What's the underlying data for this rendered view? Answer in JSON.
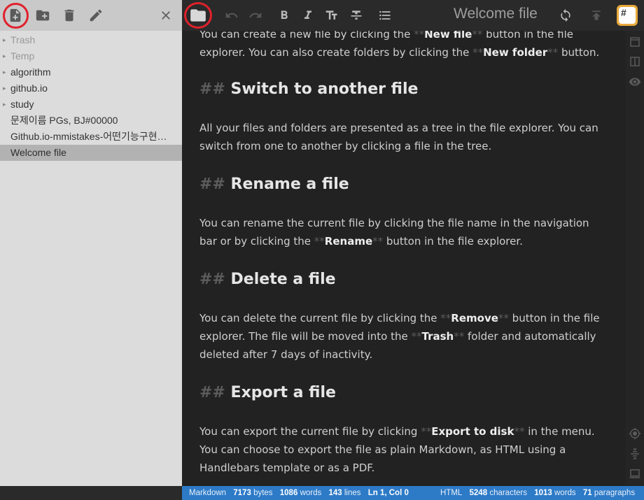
{
  "explorer": {
    "toolbar": {
      "new_file_icon": "new-file-icon",
      "new_folder_icon": "new-folder-icon",
      "delete_icon": "trash-icon",
      "rename_icon": "pencil-icon",
      "close_icon": "close-icon"
    },
    "items": [
      {
        "label": "Trash",
        "type": "folder",
        "dim": true
      },
      {
        "label": "Temp",
        "type": "folder",
        "dim": true
      },
      {
        "label": "algorithm",
        "type": "folder"
      },
      {
        "label": "github.io",
        "type": "folder"
      },
      {
        "label": "study",
        "type": "folder"
      },
      {
        "label": "문제이름 PGs, BJ#00000",
        "type": "file"
      },
      {
        "label": "Github.io-mmistakes-어떤기능구현…",
        "type": "file"
      },
      {
        "label": "Welcome file",
        "type": "file",
        "selected": true
      }
    ]
  },
  "navbar": {
    "title": "Welcome file",
    "workspace_badge": "#",
    "icons": [
      "folder-icon",
      "undo-icon",
      "redo-icon",
      "bold-icon",
      "italic-icon",
      "heading-icon",
      "strikethrough-icon",
      "list-icon",
      "sync-icon",
      "publish-icon"
    ]
  },
  "editor": {
    "p0": {
      "a": "You can create a new file by clicking the ",
      "m1": "**",
      "b": "New file",
      "m2": "**",
      "c": " button in the file explorer. You can also create folders by clicking the ",
      "m3": "**",
      "d": "New folder",
      "m4": "**",
      "e": " button."
    },
    "h1": {
      "mk": "##",
      "text": "Switch to another file"
    },
    "p1": "All your files and folders are presented as a tree in the file explorer. You can switch from one to another by clicking a file in the tree.",
    "h2": {
      "mk": "##",
      "text": "Rename a file"
    },
    "p2": {
      "a": "You can rename the current file by clicking the file name in the navigation bar or by clicking the ",
      "m1": "**",
      "b": "Rename",
      "m2": "**",
      "c": " button in the file explorer."
    },
    "h3": {
      "mk": "##",
      "text": "Delete a file"
    },
    "p3": {
      "a": "You can delete the current file by clicking the ",
      "m1": "**",
      "b": "Remove",
      "m2": "**",
      "c": " button in the file explorer. The file will be moved into the ",
      "m3": "**",
      "d": "Trash",
      "m4": "**",
      "e": " folder and automatically deleted after 7 days of inactivity."
    },
    "h4": {
      "mk": "##",
      "text": "Export a file"
    },
    "p4": {
      "a": "You can export the current file by clicking ",
      "m1": "**",
      "b": "Export to disk",
      "m2": "**",
      "c": " in the menu. You can choose to export the file as plain Markdown, as HTML using a Handlebars template or as a PDF."
    }
  },
  "sidebar": {
    "icons": [
      "editor-view-icon",
      "side-by-side-icon",
      "preview-eye-icon",
      "scroll-sync-icon",
      "navigation-icon",
      "layout-icon"
    ]
  },
  "status": {
    "left": {
      "mode": "Markdown",
      "bytes_n": "7173",
      "bytes_l": "bytes",
      "words_n": "1086",
      "words_l": "words",
      "lines_n": "143",
      "lines_l": "lines",
      "cursor": "Ln 1, Col 0"
    },
    "right": {
      "mode": "HTML",
      "chars_n": "5248",
      "chars_l": "characters",
      "words_n": "1013",
      "words_l": "words",
      "paras_n": "71",
      "paras_l": "paragraphs"
    }
  },
  "colors": {
    "highlight_circle": "#e0212b",
    "statusbar": "#2d7ac7",
    "badge": "#e8a93a"
  }
}
